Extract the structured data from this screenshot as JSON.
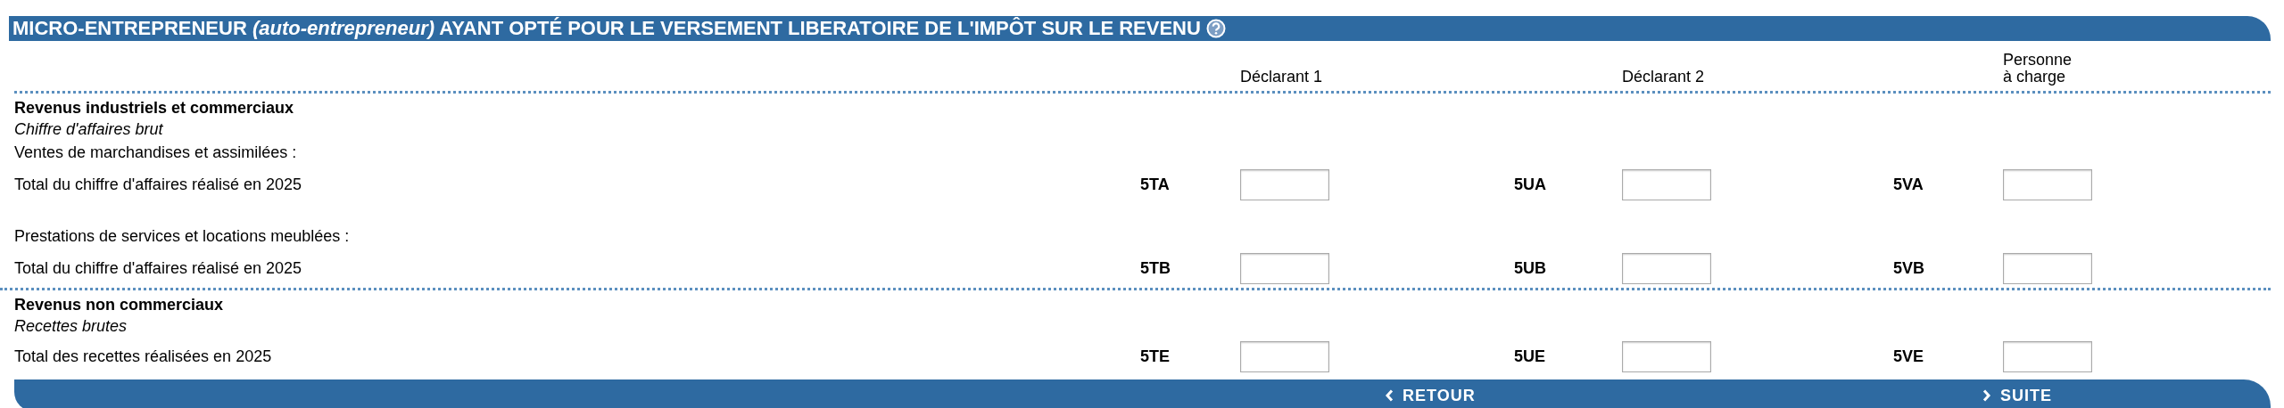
{
  "header": {
    "title": "MICRO-ENTREPRENEUR *(auto-entrepreneur)* AYANT OPTÉ POUR LE VERSEMENT LIBERATOIRE DE L'IMPÔT SUR LE REVENU"
  },
  "columns": [
    {
      "label": "Déclarant 1"
    },
    {
      "label": "Déclarant 2"
    },
    {
      "label": "Personne\nà charge"
    }
  ],
  "sections": [
    {
      "heading": "Revenus industriels et commerciaux",
      "subheading": "Chiffre d'affaires brut",
      "lines": [
        {
          "kind": "text",
          "label": "Ventes de marchandises et assimilées :"
        },
        {
          "kind": "entry",
          "label": "Total du chiffre d'affaires réalisé en 2025",
          "codes": [
            "5TA",
            "5UA",
            "5VA"
          ]
        },
        {
          "kind": "text",
          "label": "Prestations de services et locations meublées :"
        },
        {
          "kind": "entry",
          "label": "Total du chiffre d'affaires réalisé en 2025",
          "codes": [
            "5TB",
            "5UB",
            "5VB"
          ]
        }
      ]
    },
    {
      "heading": "Revenus non commerciaux",
      "subheading": "Recettes brutes",
      "lines": [
        {
          "kind": "entry",
          "label": "Total des recettes réalisées en 2025",
          "codes": [
            "5TE",
            "5UE",
            "5VE"
          ]
        }
      ]
    }
  ],
  "footer": {
    "buttons": [
      {
        "kind": "back",
        "label": "RETOUR"
      },
      {
        "kind": "next",
        "label": "SUITE"
      }
    ]
  }
}
